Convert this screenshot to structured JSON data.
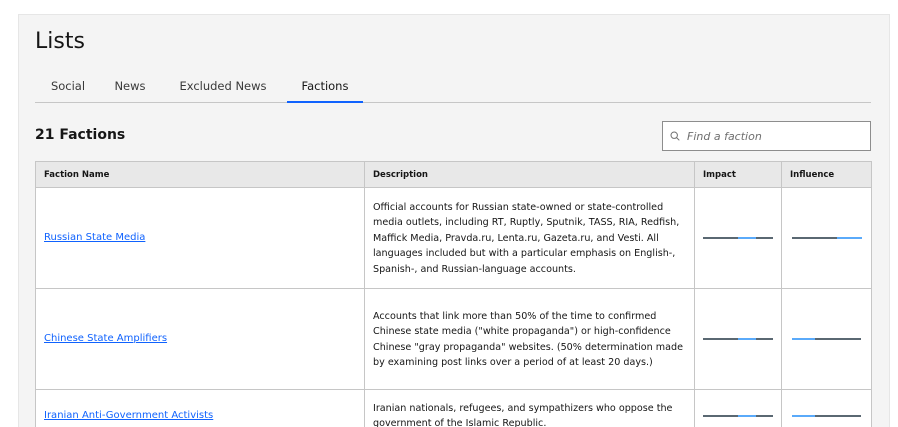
{
  "page": {
    "title": "Lists"
  },
  "tabs": [
    {
      "label": "Social",
      "active": false
    },
    {
      "label": "News",
      "active": false
    },
    {
      "label": "Excluded News",
      "active": false
    },
    {
      "label": "Factions",
      "active": true
    }
  ],
  "factions": {
    "count_title": "21 Factions",
    "search_placeholder": "Find a faction",
    "columns": [
      "Faction Name",
      "Description",
      "Impact",
      "Influence"
    ],
    "rows": [
      {
        "name": "Russian State Media",
        "description": "Official accounts for Russian state-owned or state-controlled media outlets, including RT, Ruptly, Sputnik, TASS, RIA, Redfish, Maffick Media, Pravda.ru, Lenta.ru, Gazeta.ru, and Vesti. All languages included but with a particular emphasis on English-, Spanish-, and Russian-language accounts.",
        "impact": {
          "segments": [
            0.5,
            0.25,
            0.25
          ],
          "highlight": 1
        },
        "influence": {
          "segments": [
            0.65,
            0.35
          ],
          "highlight": 1
        }
      },
      {
        "name": "Chinese State Amplifiers",
        "description": "Accounts that link more than 50% of the time to confirmed Chinese state media (\"white propaganda\") or high-confidence Chinese \"gray propaganda\" websites. (50% determination made by examining post links over a period of at least 20 days.)",
        "impact": {
          "segments": [
            0.5,
            0.25,
            0.25
          ],
          "highlight": 1
        },
        "influence": {
          "segments": [
            0.33,
            0.67
          ],
          "highlight": 0
        }
      },
      {
        "name": "Iranian Anti-Government Activists",
        "description": "Iranian nationals, refugees, and sympathizers who oppose the government of the Islamic Republic.",
        "impact": {
          "segments": [
            0.5,
            0.25,
            0.25
          ],
          "highlight": 1
        },
        "influence": {
          "segments": [
            0.33,
            0.67
          ],
          "highlight": 0
        }
      }
    ]
  },
  "colors": {
    "bar_base": "#5a6872",
    "bar_highlight": "#5aaafa",
    "link": "#0f62fe",
    "tab_indicator": "#0f62fe"
  }
}
